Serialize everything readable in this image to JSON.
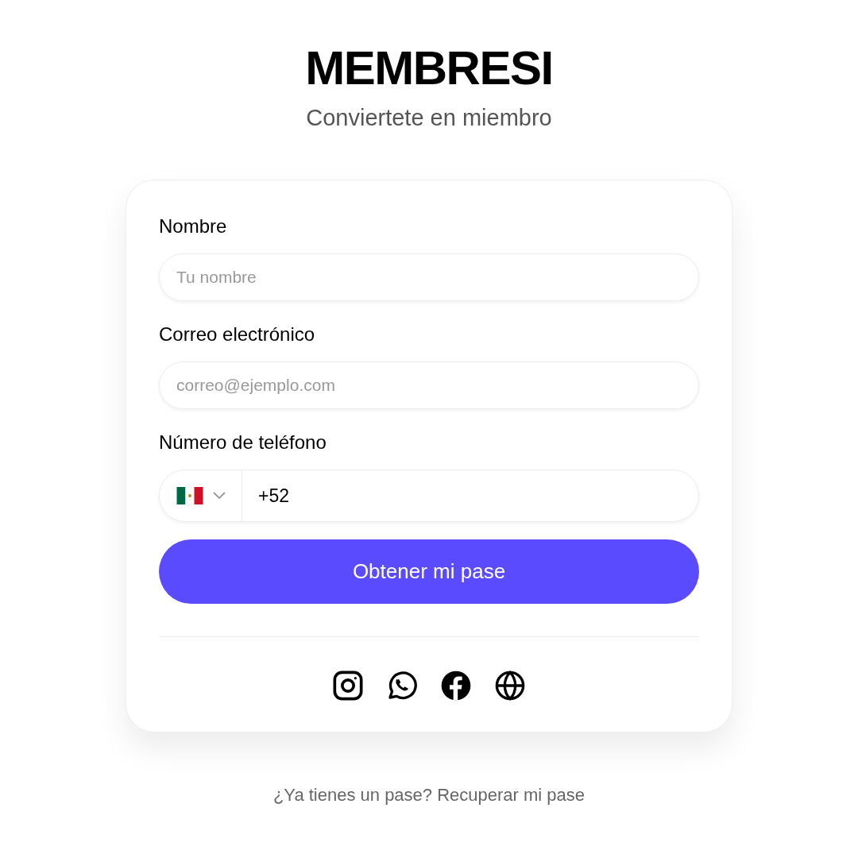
{
  "header": {
    "title": "MEMBRESI",
    "subtitle": "Conviertete en miembro"
  },
  "form": {
    "fields": [
      {
        "kind": "text",
        "label": "Nombre",
        "placeholder": "Tu nombre"
      },
      {
        "kind": "text",
        "label": "Correo electrónico",
        "placeholder": "correo@ejemplo.com"
      },
      {
        "kind": "phone",
        "label": "Número de teléfono",
        "value": "+52"
      }
    ],
    "submit": "Obtener mi pase"
  },
  "footer": {
    "prompt": "¿Ya tienes un pase?",
    "link": "Recuperar mi pase"
  }
}
